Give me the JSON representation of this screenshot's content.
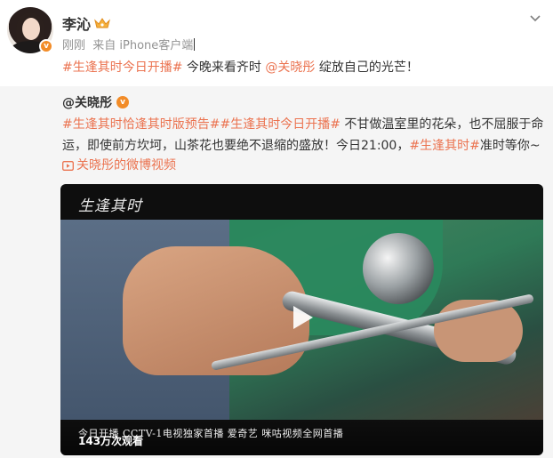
{
  "post": {
    "author_name": "李沁",
    "meta": "刚刚  来自 iPhone客户端",
    "text_segments": [
      {
        "kind": "tag",
        "text": "#生逢其时今日开播#"
      },
      {
        "kind": "plain",
        "text": " 今晚来看齐时 "
      },
      {
        "kind": "mention",
        "text": "@关晓彤"
      },
      {
        "kind": "plain",
        "text": " 绽放自己的光芒！"
      }
    ]
  },
  "repost": {
    "author": "@关晓彤",
    "segments": [
      {
        "kind": "tag",
        "text": "#生逢其时恰逢其时版预告##生逢其时今日开播#"
      },
      {
        "kind": "plain",
        "text": " 不甘做温室里的花朵，也不屈服于命运，即使前方坎坷，山茶花也要绝不退缩的盛放！今日21:00，"
      },
      {
        "kind": "tag",
        "text": "#生逢其时#"
      },
      {
        "kind": "plain",
        "text": "准时等你~"
      }
    ],
    "video_link": "关晓彤的微博视频",
    "video": {
      "logo_text": "生逢其时",
      "caption": "今日开播 CCTV-1电视独家首播 爱奇艺 咪咕视频全网首播",
      "views": "143万次观看"
    }
  },
  "icons": {
    "crown": "crown-icon",
    "verified": "verified-icon",
    "more": "chevron-down-icon",
    "video": "video-icon",
    "play": "play-icon"
  },
  "colors": {
    "link": "#eb7350",
    "badge": "#f28c28",
    "repost_bg": "#f5f5f5"
  }
}
